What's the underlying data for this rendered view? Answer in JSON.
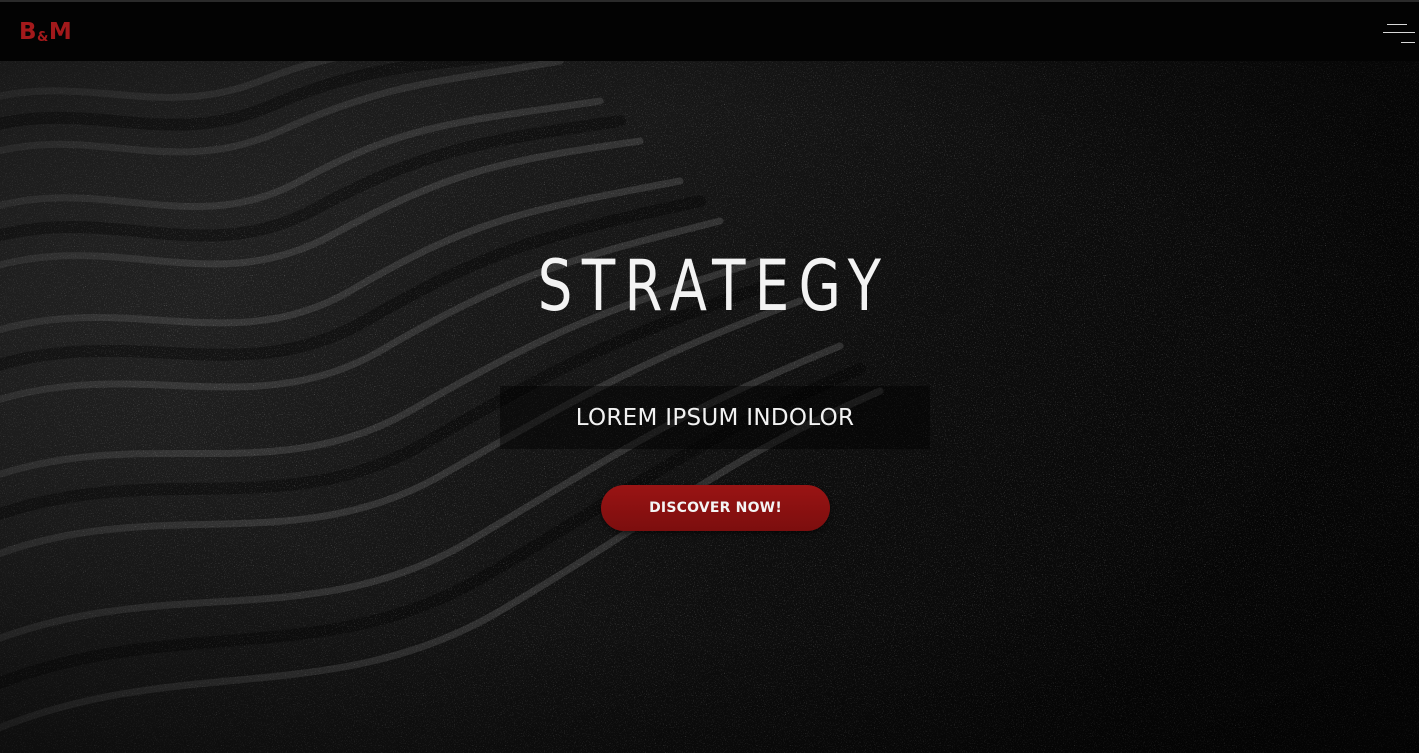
{
  "header": {
    "logo": {
      "left": "B",
      "amp": "&",
      "right": "M"
    },
    "menu_icon": "hamburger-menu-icon"
  },
  "hero": {
    "background": "dark-sand-dunes-image",
    "title": "STRATEGY",
    "subtitle": "LOREM IPSUM INDOLOR",
    "cta_label": "DISCOVER NOW!"
  },
  "colors": {
    "brand_red": "#a3191b",
    "button_red": "#8b1111",
    "nav_bg": "#030303",
    "text": "#f3f3f3"
  }
}
